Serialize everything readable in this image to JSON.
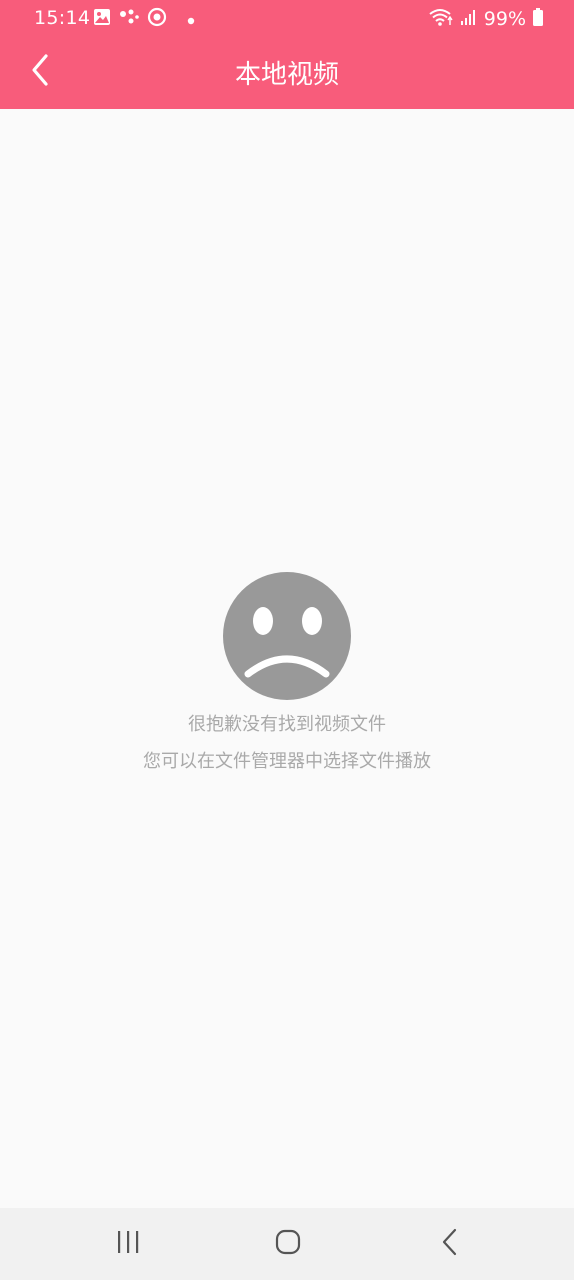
{
  "status_bar": {
    "time": "15:14",
    "battery_percent": "99%",
    "icons_left": [
      "image-icon",
      "assistant-dots-icon",
      "target-icon",
      "dot-icon"
    ],
    "icons_right": [
      "wifi-icon",
      "signal-icon",
      "battery-icon"
    ]
  },
  "header": {
    "title": "本地视频",
    "background_color": "#f85c7b",
    "back_icon": "chevron-left-icon"
  },
  "empty_state": {
    "icon": "sad-face-icon",
    "icon_color": "#999999",
    "message": "很抱歉没有找到视频文件",
    "hint": "您可以在文件管理器中选择文件播放"
  },
  "nav_bar": {
    "buttons": [
      "recent-apps-icon",
      "home-icon",
      "back-icon"
    ]
  }
}
